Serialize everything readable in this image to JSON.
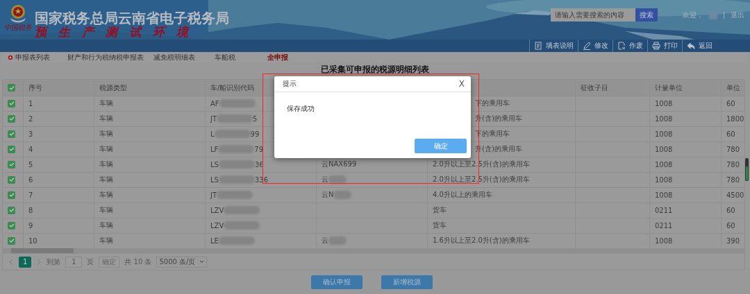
{
  "header": {
    "emblem_caption": "中国税务",
    "title": "国家税务总局云南省电子税务局",
    "subtitle": "预生产测试环境",
    "search": {
      "placeholder": "请输入需要搜索的内容",
      "button": "搜索"
    },
    "welcome": "欢迎，",
    "separator": "|",
    "logout": "退出"
  },
  "toolbar": [
    {
      "label": "填表说明",
      "kind": "doc"
    },
    {
      "label": "修改",
      "kind": "edit"
    },
    {
      "label": "作废",
      "kind": "void"
    },
    {
      "label": "打印",
      "kind": "print"
    },
    {
      "label": "返回",
      "kind": "back"
    }
  ],
  "tabs": [
    {
      "label": "申报表列表",
      "kind": "home",
      "selected": false
    },
    {
      "label": "财产和行为税纳税申报表",
      "kind": "tab",
      "selected": false
    },
    {
      "label": "减免税明细表",
      "kind": "tab",
      "selected": false
    },
    {
      "label": "车船税",
      "kind": "tab",
      "selected": false
    },
    {
      "label": "全申报",
      "kind": "tab",
      "selected": true
    }
  ],
  "table": {
    "title": "已采集可申报的税源明细列表",
    "all_checked": true,
    "columns": [
      "序号",
      "税源类型",
      "车/船识别代码",
      null,
      null,
      "征收子目",
      "计量单位",
      "单位"
    ],
    "rows": [
      {
        "checked": true,
        "no": "1",
        "type": "车辆",
        "code_start": "AF",
        "code_masked": true,
        "desc": "下的乘用车",
        "unit": "1008",
        "rate": "60"
      },
      {
        "checked": true,
        "no": "2",
        "type": "车辆",
        "code_start": "JT",
        "code_masked": true,
        "code_end": "5",
        "desc": "升(含)的乘用车",
        "unit": "1008",
        "rate": "1800"
      },
      {
        "checked": true,
        "no": "3",
        "type": "车辆",
        "code_start": "L",
        "code_masked": true,
        "code_end": "99",
        "desc": "下的乘用车",
        "unit": "1008",
        "rate": "60"
      },
      {
        "checked": true,
        "no": "4",
        "type": "车辆",
        "code_start": "LF",
        "code_masked": true,
        "code_end": "79",
        "desc": "升(含)的乘用车",
        "unit": "1008",
        "rate": "780"
      },
      {
        "checked": true,
        "no": "5",
        "type": "车辆",
        "code_start": "LS",
        "code_masked": true,
        "code_end": "36",
        "plate": "云NAX699",
        "desc": "2.0升以上至2.5升(含)的乘用车",
        "unit": "1008",
        "rate": "780"
      },
      {
        "checked": true,
        "no": "6",
        "type": "车辆",
        "code_start": "LS",
        "code_masked": true,
        "code_end": "336",
        "plate": "云",
        "plate_masked": true,
        "desc": "2.0升以上至2.5升(含)的乘用车",
        "unit": "1008",
        "rate": "780"
      },
      {
        "checked": true,
        "no": "7",
        "type": "车辆",
        "code_start": "JT",
        "code_masked": true,
        "plate": "云N",
        "plate_masked": true,
        "desc": "4.0升以上的乘用车",
        "unit": "1008",
        "rate": "4500"
      },
      {
        "checked": true,
        "no": "8",
        "type": "车辆",
        "code_start": "LZV",
        "code_masked": true,
        "desc": "货车",
        "unit": "0211",
        "rate": "60"
      },
      {
        "checked": true,
        "no": "9",
        "type": "车辆",
        "code_start": "LZV",
        "code_masked": true,
        "desc": "货车",
        "unit": "0211",
        "rate": "60"
      },
      {
        "checked": true,
        "no": "10",
        "type": "车辆",
        "code_start": "LE",
        "code_masked": true,
        "plate": "云",
        "plate_masked": true,
        "desc": "1.6升以上至2.0升(含)的乘用车",
        "unit": "1008",
        "rate": "390"
      }
    ]
  },
  "pagination": {
    "pages": [
      {
        "label": "1",
        "selected": true
      }
    ],
    "goto_prefix": "到第",
    "goto_value": "1",
    "goto_suffix": "页",
    "goto_button": "确定",
    "total": "共 10 条",
    "page_size": "5000 条/页"
  },
  "actions": [
    "确认申报",
    "新增税源"
  ],
  "dialog": {
    "title": "提示",
    "close": "X",
    "message": "保存成功",
    "button": "确定"
  }
}
